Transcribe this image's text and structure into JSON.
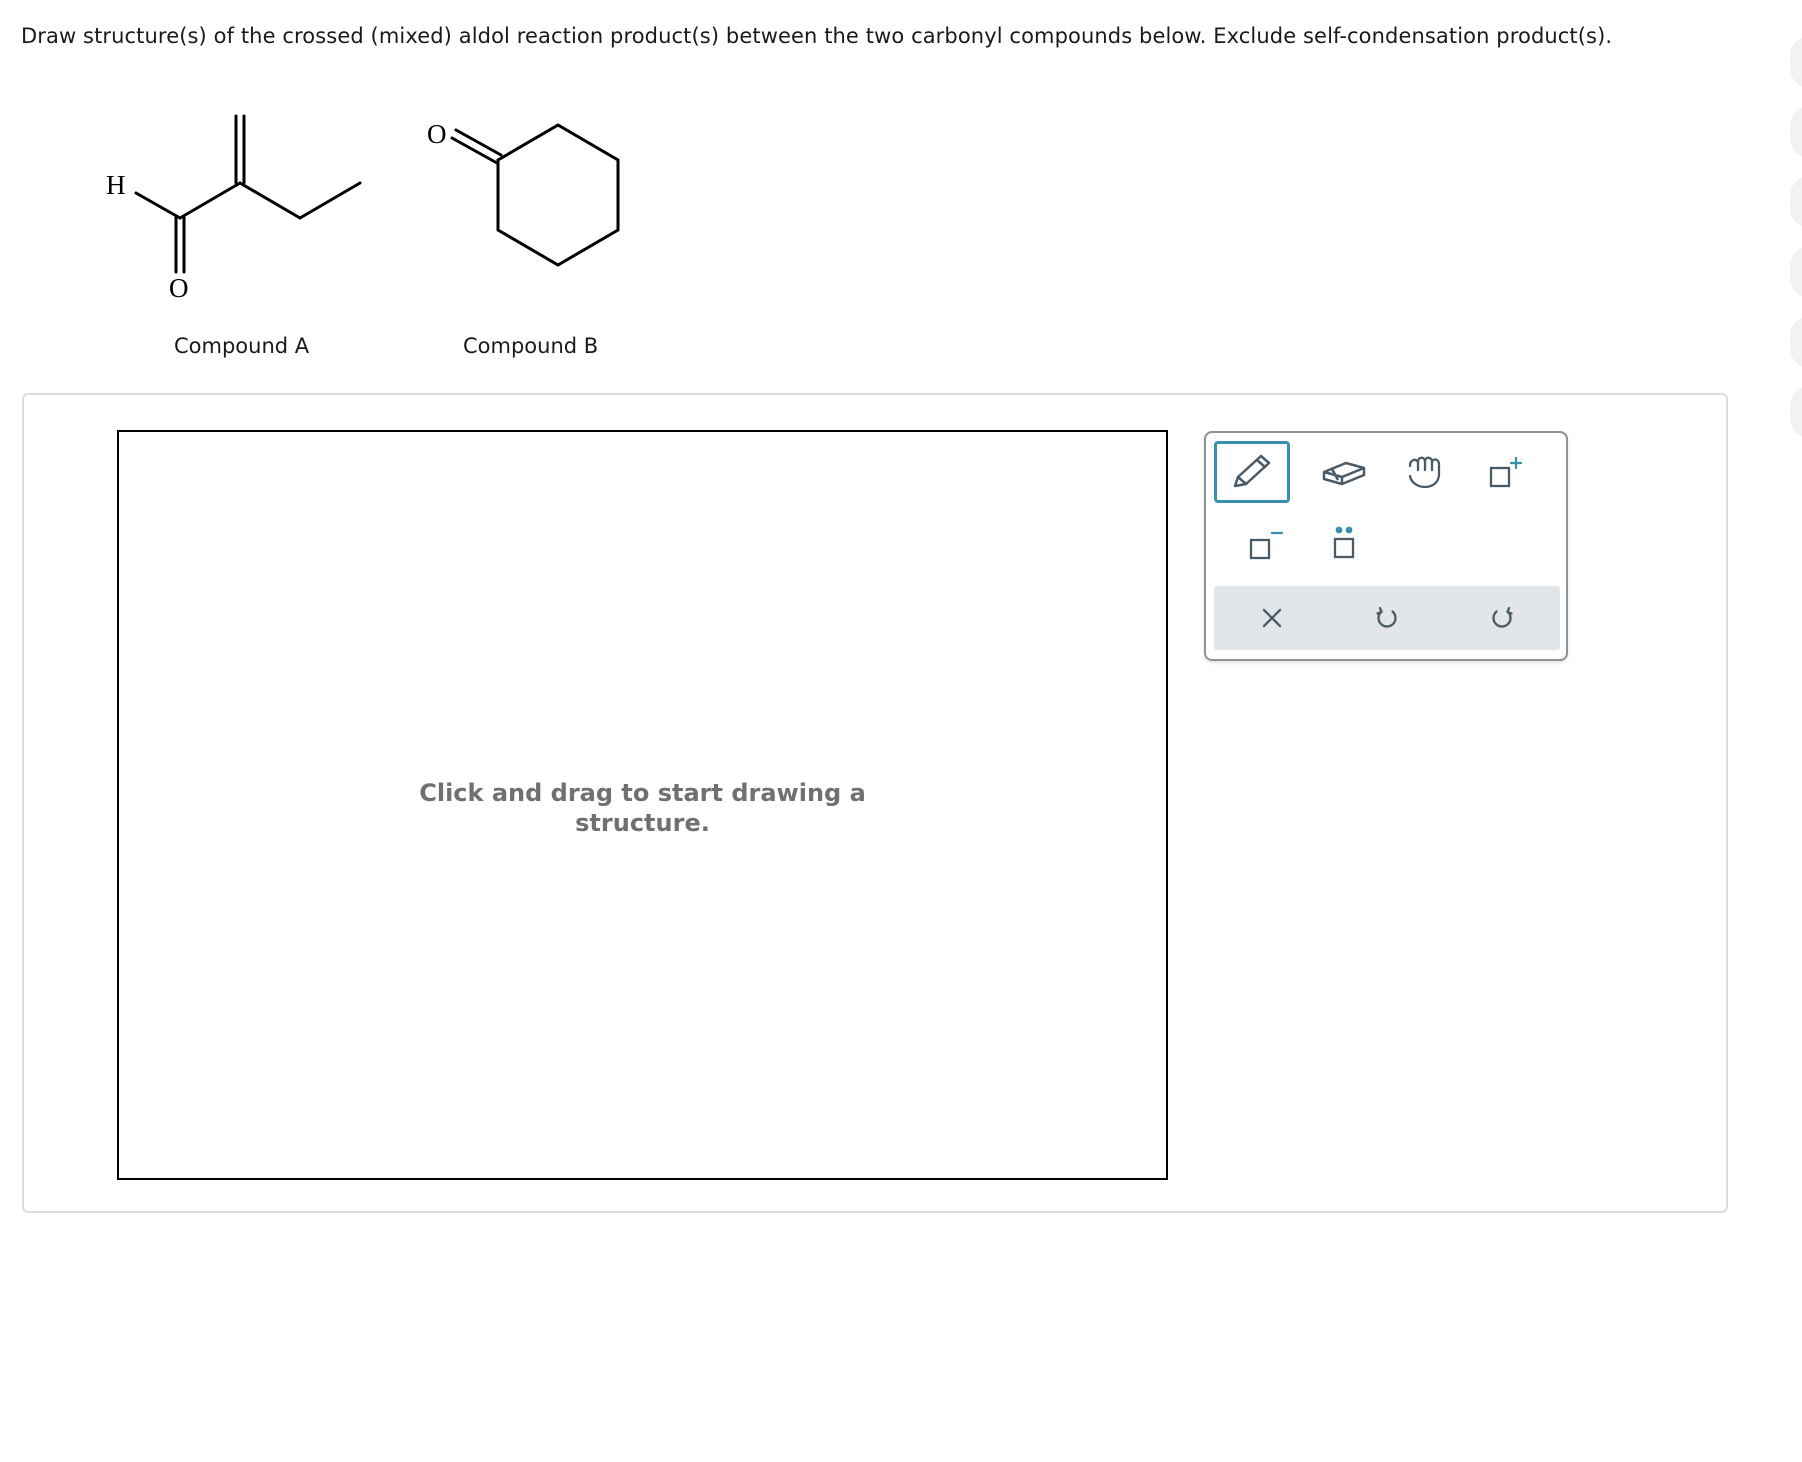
{
  "question": {
    "text": "Draw structure(s) of the crossed (mixed) aldol reaction product(s) between the two carbonyl compounds below. Exclude self-condensation product(s)."
  },
  "compounds": {
    "a": {
      "label": "Compound A",
      "atom_h": "H",
      "atom_o": "O"
    },
    "b": {
      "label": "Compound B",
      "atom_o": "O"
    }
  },
  "canvas": {
    "hint": "Click and drag to start drawing a structure."
  },
  "toolbox": {
    "tools": [
      {
        "id": "pencil",
        "icon": "pencil-icon",
        "active": true
      },
      {
        "id": "eraser",
        "icon": "eraser-icon",
        "active": false
      },
      {
        "id": "move",
        "icon": "hand-icon",
        "active": false
      },
      {
        "id": "positive-charge",
        "icon": "positive-charge-icon",
        "active": false
      },
      {
        "id": "negative-charge",
        "icon": "negative-charge-icon",
        "active": false
      },
      {
        "id": "lone-pair",
        "icon": "lone-pair-icon",
        "active": false
      }
    ],
    "actions": [
      {
        "id": "clear",
        "icon": "close-icon"
      },
      {
        "id": "undo",
        "icon": "undo-icon"
      },
      {
        "id": "redo",
        "icon": "redo-icon"
      }
    ]
  },
  "colors": {
    "accent": "#3a8fac",
    "icon_stroke": "#4a5a66",
    "hint_text": "#707070"
  }
}
